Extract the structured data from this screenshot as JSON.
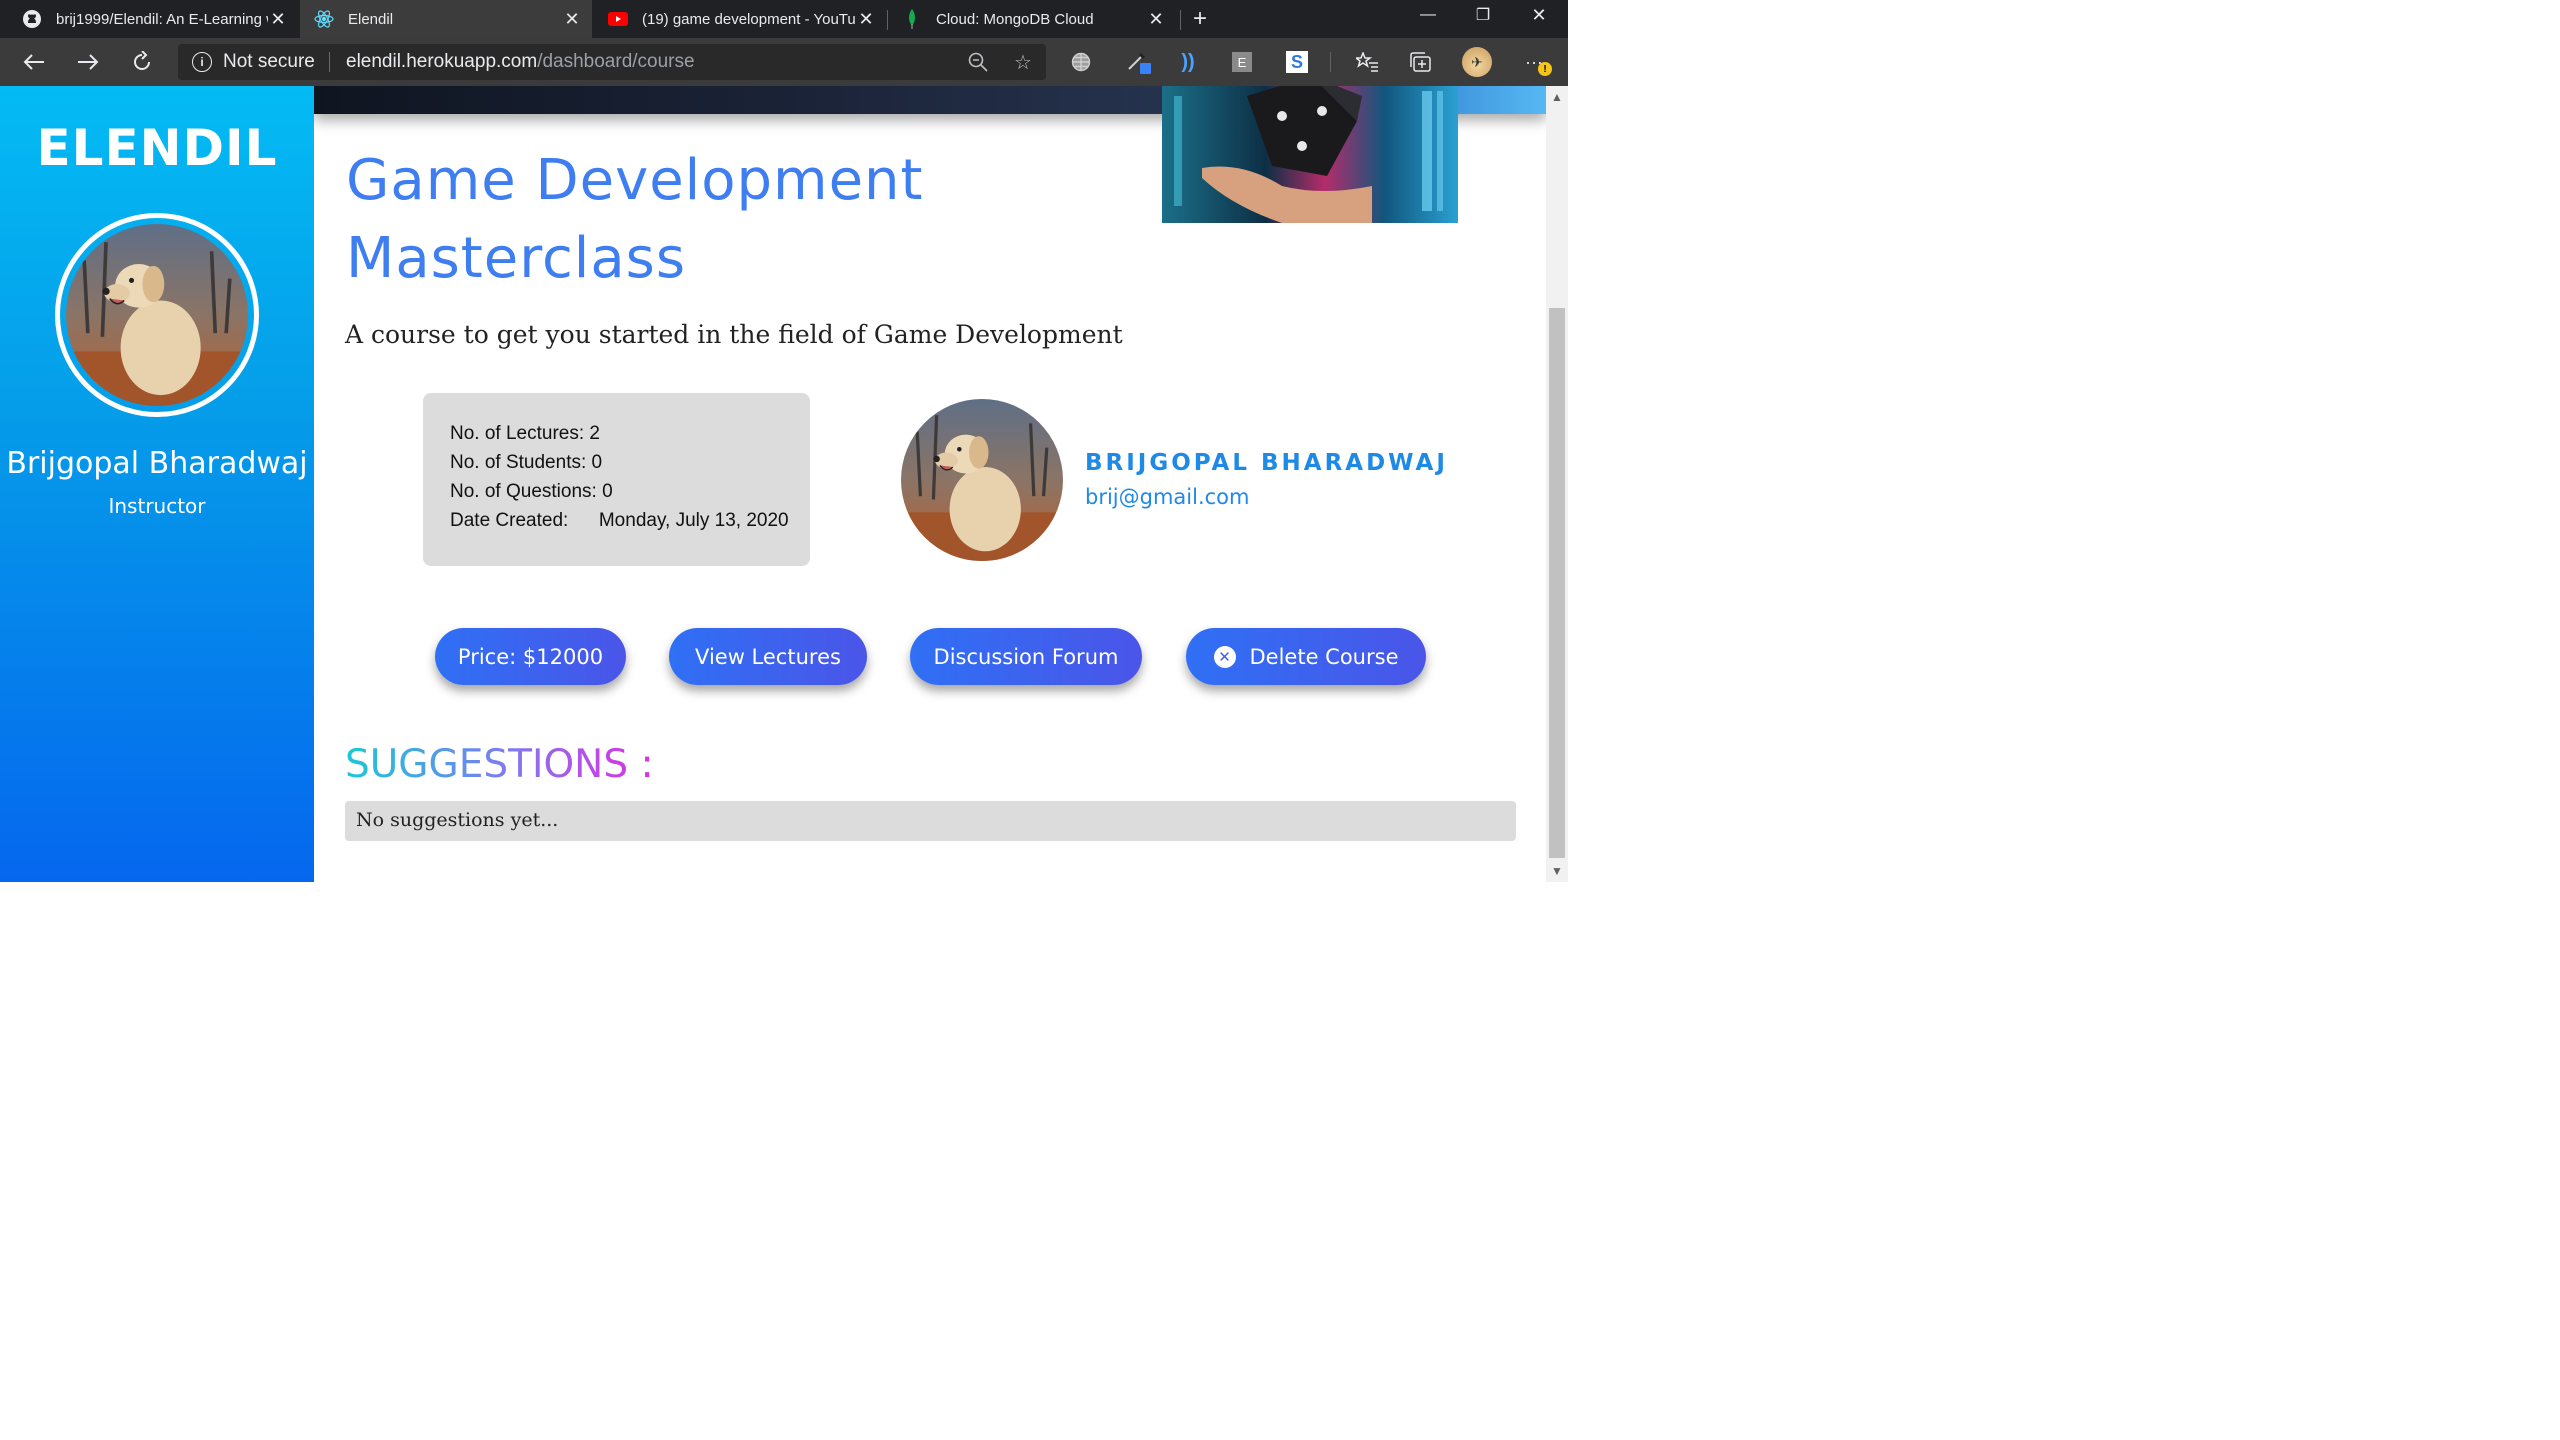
{
  "browser": {
    "tabs": [
      {
        "title": "brij1999/Elendil: An E-Learning w",
        "icon": "github-icon"
      },
      {
        "title": "Elendil",
        "icon": "react-icon",
        "active": true
      },
      {
        "title": "(19) game development - YouTul",
        "icon": "youtube-icon"
      },
      {
        "title": "Cloud: MongoDB Cloud",
        "icon": "mongodb-leaf-icon"
      }
    ],
    "security_label": "Not secure",
    "url_host": "elendil.herokuapp.com",
    "url_path": "/dashboard/course"
  },
  "sidebar": {
    "logo": "ELENDIL",
    "user_name": "Brijgopal Bharadwaj",
    "user_role": "Instructor"
  },
  "course": {
    "title_line1": "Game Development",
    "title_line2": "Masterclass",
    "description": "A course to get you started in the field of Game Development",
    "stats": {
      "lectures": "No. of Lectures: 2",
      "students": "No. of Students: 0",
      "questions": "No. of Questions: 0",
      "created_label": "Date Created:",
      "created_value": "Monday, July 13, 2020"
    }
  },
  "instructor": {
    "name": "BRIJGOPAL BHARADWAJ",
    "email": "brij@gmail.com"
  },
  "actions": {
    "price": "Price: $12000",
    "view_lectures": "View Lectures",
    "discussion_forum": "Discussion Forum",
    "delete_course": "Delete Course"
  },
  "suggestions": {
    "heading": "SUGGESTIONS :",
    "empty_text": "No suggestions yet..."
  },
  "colors": {
    "accent": "#3f7ef0",
    "sidebar_top": "#04bbf4",
    "sidebar_bottom": "#0567ee"
  }
}
